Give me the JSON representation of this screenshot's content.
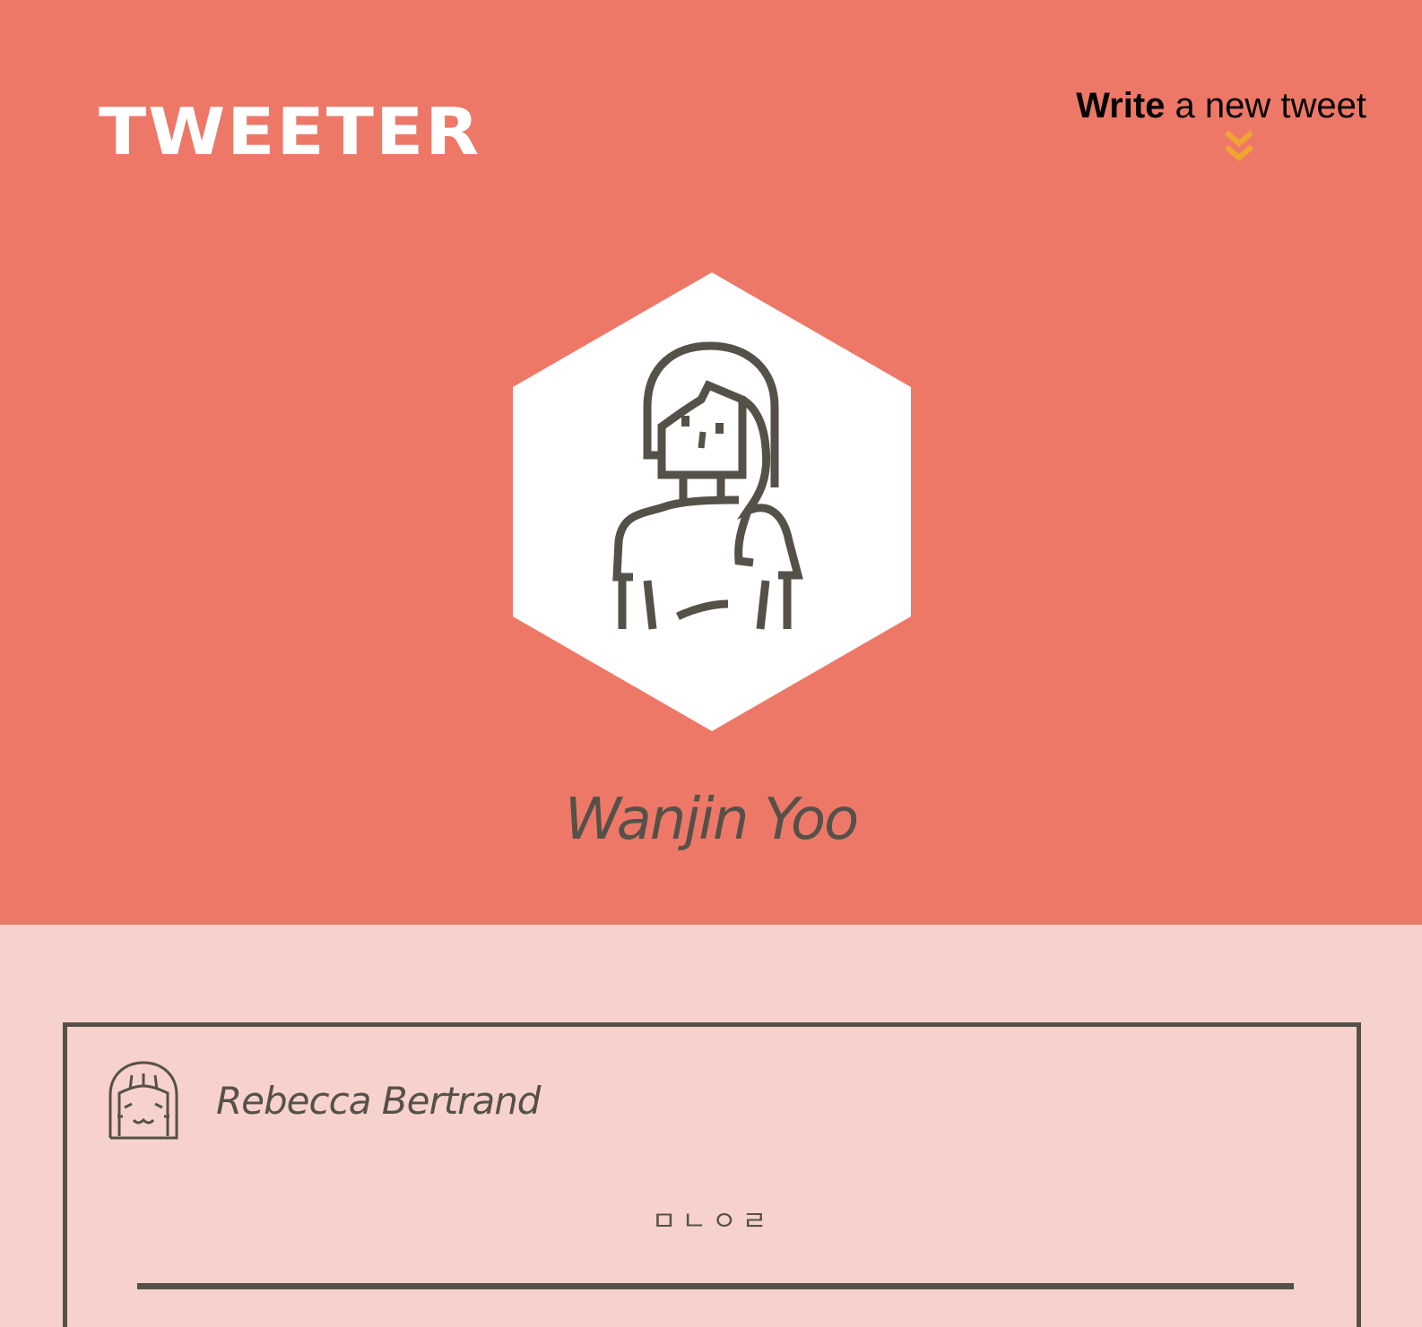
{
  "app": {
    "logo": "TWEETER"
  },
  "compose": {
    "write_label": "Write",
    "rest_label": " a new tweet",
    "icon": "double-chevron-down-icon",
    "icon_color": "#f0a530"
  },
  "profile": {
    "name": "Wanjin Yoo",
    "avatar_icon": "woman-avatar-icon"
  },
  "tweets": [
    {
      "author": "Rebecca Bertrand",
      "avatar_icon": "girl-avatar-icon",
      "text": "ㅁㄴㅇㄹ"
    }
  ],
  "colors": {
    "header_bg": "#ee7868",
    "page_bg": "#f7d2cc",
    "ink": "#555149",
    "logo": "#ffffff"
  }
}
